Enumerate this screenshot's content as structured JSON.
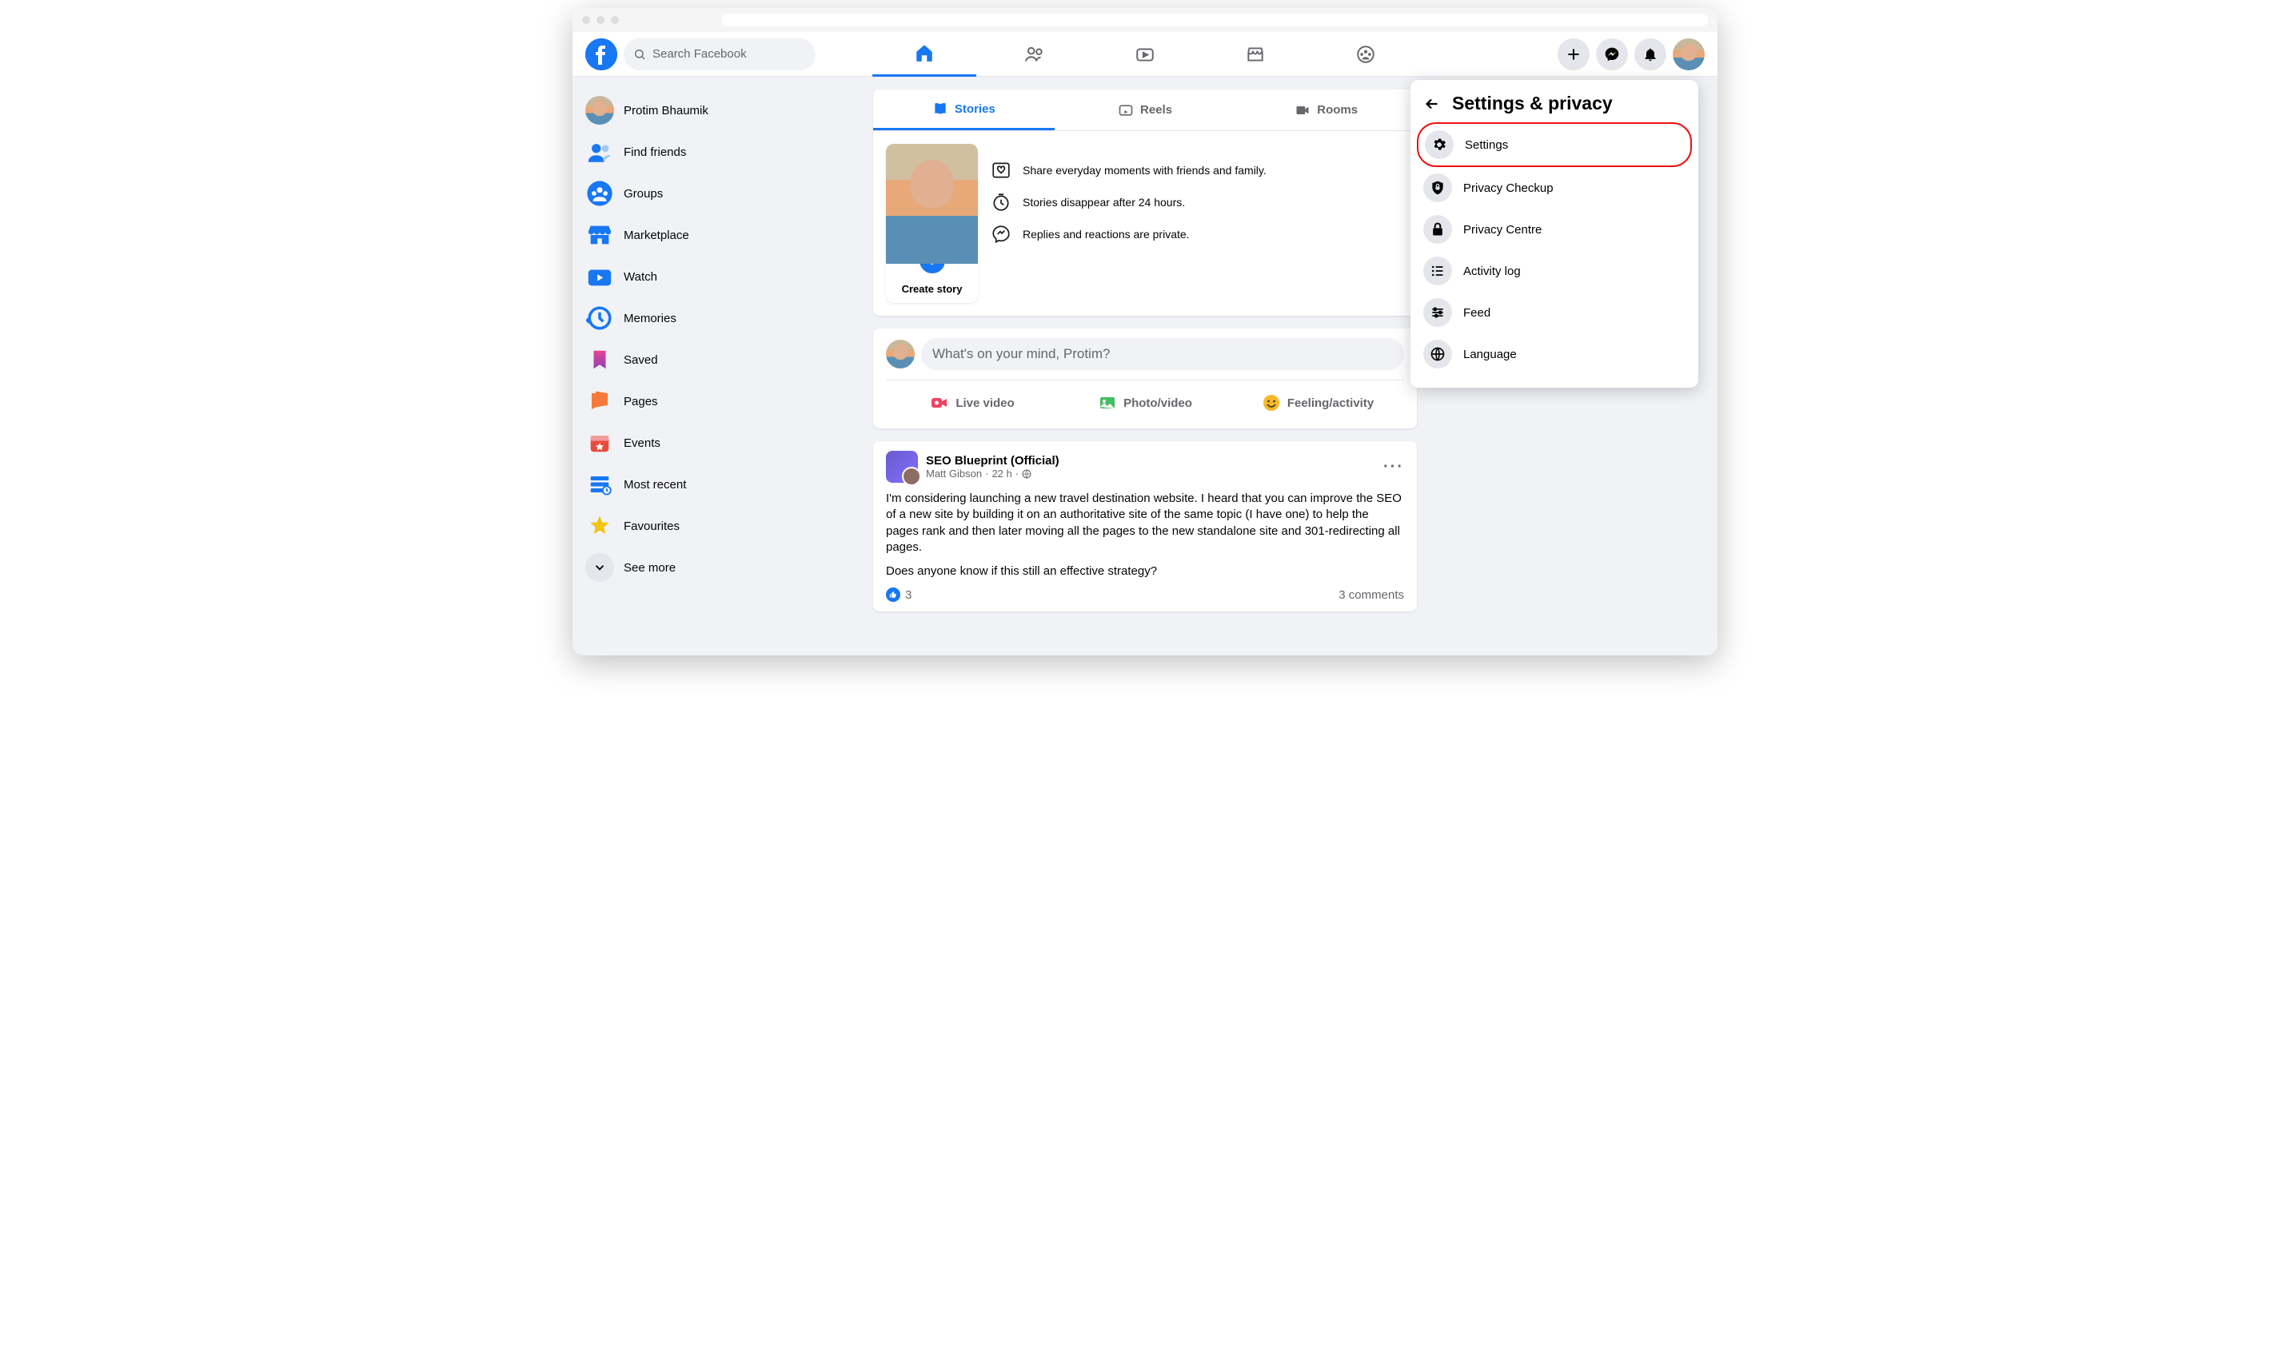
{
  "search": {
    "placeholder": "Search Facebook"
  },
  "user": {
    "name": "Protim Bhaumik"
  },
  "sidebar": {
    "items": [
      {
        "label": "Protim Bhaumik"
      },
      {
        "label": "Find friends"
      },
      {
        "label": "Groups"
      },
      {
        "label": "Marketplace"
      },
      {
        "label": "Watch"
      },
      {
        "label": "Memories"
      },
      {
        "label": "Saved"
      },
      {
        "label": "Pages"
      },
      {
        "label": "Events"
      },
      {
        "label": "Most recent"
      },
      {
        "label": "Favourites"
      },
      {
        "label": "See more"
      }
    ]
  },
  "stories_card": {
    "tabs": {
      "stories": "Stories",
      "reels": "Reels",
      "rooms": "Rooms"
    },
    "create_label": "Create story",
    "info1": "Share everyday moments with friends and family.",
    "info2": "Stories disappear after 24 hours.",
    "info3": "Replies and reactions are private."
  },
  "composer": {
    "placeholder": "What's on your mind, Protim?",
    "live": "Live video",
    "photo": "Photo/video",
    "feeling": "Feeling/activity"
  },
  "post": {
    "group": "SEO Blueprint (Official)",
    "author": "Matt Gibson",
    "time": "22 h",
    "body1": "I'm considering launching a new travel destination website. I heard that you can improve the SEO of a new site by building it on an authoritative site of the same topic (I have one) to help the pages rank and then later moving all the pages to the new standalone site and 301-redirecting all pages.",
    "body2": "Does anyone know if this still an effective strategy?",
    "likes": "3",
    "comments": "3 comments"
  },
  "dropdown": {
    "title": "Settings & privacy",
    "items": {
      "settings": "Settings",
      "privacy_checkup": "Privacy Checkup",
      "privacy_centre": "Privacy Centre",
      "activity_log": "Activity log",
      "feed": "Feed",
      "language": "Language"
    }
  }
}
